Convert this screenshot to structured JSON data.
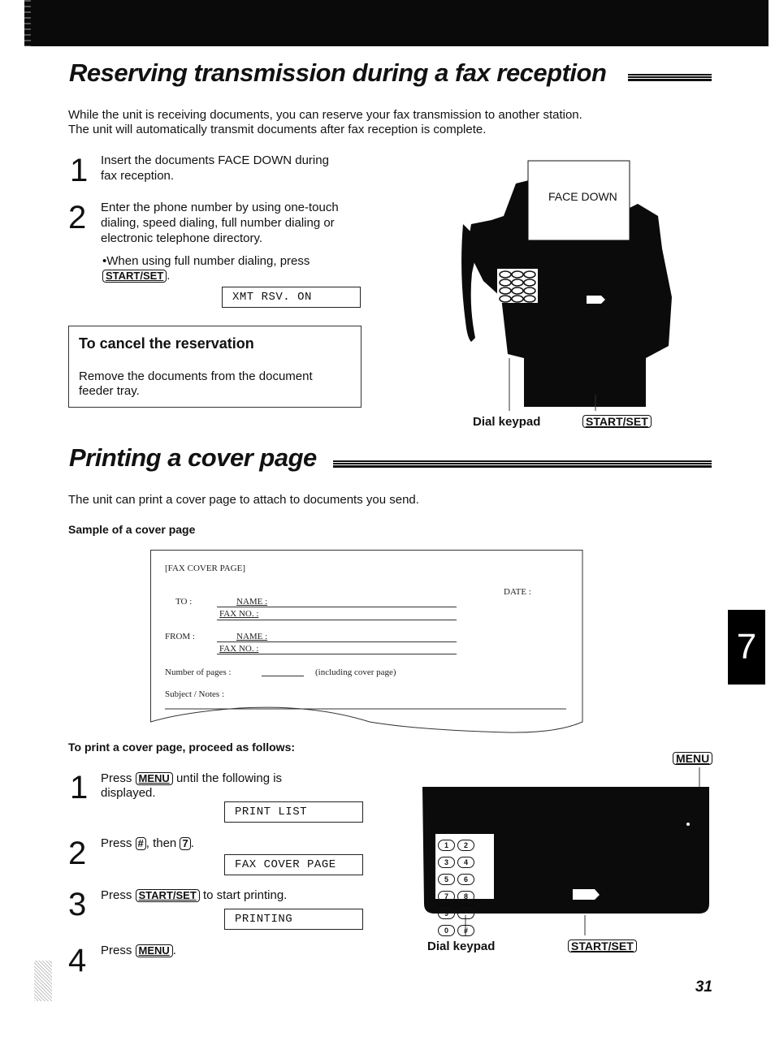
{
  "section1": {
    "title": "Reserving transmission during a fax reception",
    "intro_line1": "While the unit is receiving documents, you can reserve your fax transmission to another station.",
    "intro_line2": "The unit will automatically transmit documents after fax reception is complete.",
    "steps": [
      {
        "num": "1",
        "line1": "Insert the documents FACE DOWN during",
        "line2": "fax reception."
      },
      {
        "num": "2",
        "line1": "Enter the phone number by using one-touch",
        "line2": "dialing, speed dialing, full number dialing or",
        "line3": "electronic telephone directory.",
        "note_prefix": "•When using full number dialing, press",
        "note_key": "START/SET",
        "note_suffix": ".",
        "display": "XMT RSV. ON"
      }
    ],
    "cancel_box": {
      "heading": "To cancel the reservation",
      "line1": "Remove the documents from the document",
      "line2": "feeder tray."
    },
    "illustration": {
      "paper_label": "FACE DOWN",
      "label_keypad": "Dial keypad",
      "label_startset": "START/SET"
    }
  },
  "section2": {
    "title": "Printing a cover page",
    "intro": "The unit can print a cover page to attach to documents you send.",
    "sample_heading": "Sample of a cover page",
    "cover_sample": {
      "header": "[FAX COVER PAGE]",
      "date_label": "DATE :",
      "to_label": "TO :",
      "from_label": "FROM :",
      "name_label": "NAME :",
      "faxno_label": "FAX NO. :",
      "pages_label": "Number of pages :",
      "pages_note": "(including cover page)",
      "subject_label": "Subject / Notes :"
    },
    "proceed_heading": "To print a cover page, proceed as follows:",
    "steps": [
      {
        "num": "1",
        "pre": "Press",
        "key": "MENU",
        "post": "until the following is",
        "line2": "displayed.",
        "display": "PRINT LIST"
      },
      {
        "num": "2",
        "pre": "Press",
        "key": "#",
        "mid": ", then",
        "key2": "7",
        "post": ".",
        "display": "FAX COVER PAGE"
      },
      {
        "num": "3",
        "pre": "Press",
        "key": "START/SET",
        "post": "to start printing.",
        "display": "PRINTING"
      },
      {
        "num": "4",
        "pre": "Press",
        "key": "MENU",
        "post": "."
      }
    ],
    "illustration": {
      "label_menu": "MENU",
      "label_keypad": "Dial keypad",
      "label_startset": "START/SET",
      "keys": [
        "1",
        "2",
        "3",
        "4",
        "5",
        "6",
        "7",
        "8",
        "9",
        "*",
        "0",
        "#"
      ]
    }
  },
  "chapter_tab": "7",
  "page_number": "31"
}
